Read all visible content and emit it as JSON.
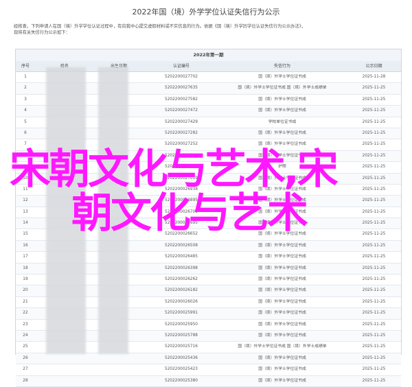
{
  "page": {
    "title": "2022年国（境）外学学位认证失信行为公示",
    "intro_line1": "经核查，下列申请人在国（境）外学学位认证过程中，有向我中心提交虚假材料或不实信息的行为。依据《国（境）外学历学位认证失信行为公示办法》，",
    "intro_line2": "现将有关失信行为公示如下："
  },
  "table": {
    "caption": "2022年第一期",
    "headers": {
      "no": "序号",
      "name": "姓名",
      "birth": "出生日期",
      "cert": "认证编号",
      "item": "失信行为",
      "published": "公示日期"
    },
    "rows": [
      {
        "no": "1",
        "cert": "5202200027702",
        "item": "国（境）外学士学位证书成",
        "published": "2025-11-28"
      },
      {
        "no": "2",
        "cert": "5202200027635",
        "item": "国（境）外学士学位证书成 国（境）外学士成绩单",
        "published": "2025-11-25"
      },
      {
        "no": "3",
        "cert": "5202200027582",
        "item": "国（境）外学士学位证书成",
        "published": "2025-11-25"
      },
      {
        "no": "4",
        "cert": "5202200027472",
        "item": "国（境）外学士学位证书成",
        "published": "2025-11-25"
      },
      {
        "no": "5",
        "cert": "5202200027429",
        "item": "学校单位证书成",
        "published": "2025-11-25"
      },
      {
        "no": "6",
        "cert": "5202200027282",
        "item": "国（境）外学士学位证书成",
        "published": "2025-11-25"
      },
      {
        "no": "7",
        "cert": "5202200027252",
        "item": "国（境）外学士学位证书成",
        "published": "2025-11-25"
      },
      {
        "no": "8",
        "cert": "5202200027135",
        "item": "国（境）外学士学位证书成",
        "published": "2025-11-25"
      },
      {
        "no": "9",
        "cert": "5202200027063",
        "item": "护照",
        "published": "2025-11-25"
      },
      {
        "no": "10",
        "cert": "5202200027019",
        "item": "国（境）外学士学位证书成",
        "published": "2025-11-25"
      },
      {
        "no": "11",
        "cert": "5202200026938",
        "item": "国（境）外学士学位证书成",
        "published": "2025-11-25"
      },
      {
        "no": "12",
        "cert": "5202200026895",
        "item": "国（境）外学士学位证书成",
        "published": "2025-11-25"
      },
      {
        "no": "13",
        "cert": "5202200026701",
        "item": "国（境）外学士学位证书成",
        "published": "2025-11-25"
      },
      {
        "no": "14",
        "cert": "5202200026695",
        "item": "国（境）外学士学位证书成",
        "published": "2025-11-25"
      },
      {
        "no": "15",
        "cert": "5202200026652",
        "item": "国（境）外学士学位证书成",
        "published": "2025-11-25"
      },
      {
        "no": "16",
        "cert": "5202200026508",
        "item": "国（境）外学士学位证书成",
        "published": "2025-11-25"
      },
      {
        "no": "17",
        "cert": "5202200026485",
        "item": "国（境）外学士学位证书成",
        "published": "2025-11-25"
      },
      {
        "no": "18",
        "cert": "5202200026398",
        "item": "国（境）外学士学位证书成",
        "published": "2025-11-25"
      },
      {
        "no": "19",
        "cert": "5202200026262",
        "item": "国（境）外学士学位证书成",
        "published": "2025-11-25"
      },
      {
        "no": "20",
        "cert": "5202200026182",
        "item": "国（境）外学士学位证书成",
        "published": "2025-11-25"
      },
      {
        "no": "21",
        "cert": "5202200026026",
        "item": "国（境）外学士学位证书成",
        "published": "2025-11-25"
      },
      {
        "no": "22",
        "cert": "5202200025991",
        "item": "国（境）外学士学位证书成",
        "published": "2025-11-25"
      },
      {
        "no": "23",
        "cert": "5202200025950",
        "item": "国（境）外学士学位证书成",
        "published": "2025-11-25"
      },
      {
        "no": "24",
        "cert": "5202200025788",
        "item": "国（境）外学士学位证书成",
        "published": "2025-11-25"
      },
      {
        "no": "25",
        "cert": "5202200025716",
        "item": "国（境）外学士学位证书成 国（境）外学士成绩单",
        "published": "2025-11-25"
      },
      {
        "no": "26",
        "cert": "5202200025436",
        "item": "国（境）外学士学位证书成",
        "published": "2025-11-25"
      },
      {
        "no": "27",
        "cert": "5202200025423",
        "item": "国（境）外学士学位证书成",
        "published": "2025-11-25"
      },
      {
        "no": "28",
        "cert": "5202200025380",
        "item": "国（境）外学士学位证书成",
        "published": "2025-11-25"
      }
    ]
  },
  "overlay": {
    "line1": "宋朝文化与艺术,宋",
    "line2": "朝文化与艺术",
    "color": "#ff18ff"
  }
}
